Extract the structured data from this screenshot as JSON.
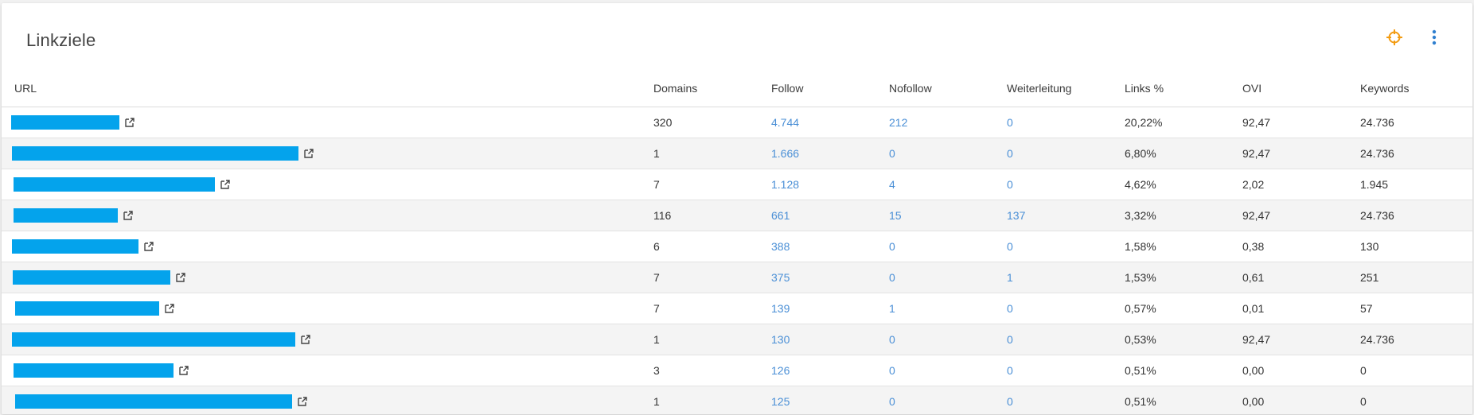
{
  "card": {
    "title": "Linkziele",
    "target_icon": "crosshair-icon",
    "more_icon": "more-vert-icon"
  },
  "colors": {
    "accent_orange": "#f39c12",
    "more_blue": "#2f7fcf",
    "link_blue": "#4a8fd6",
    "redaction_blue": "#04a3ec"
  },
  "table": {
    "headers": {
      "url": "URL",
      "domains": "Domains",
      "follow": "Follow",
      "nofollow": "Nofollow",
      "weiterleitung": "Weiterleitung",
      "links_pct": "Links %",
      "ovi": "OVI",
      "keywords": "Keywords"
    },
    "rows": [
      {
        "domains": "320",
        "follow": "4.744",
        "nofollow": "212",
        "weiterleitung": "0",
        "links_pct": "20,22%",
        "ovi": "92,47",
        "keywords": "24.736"
      },
      {
        "domains": "1",
        "follow": "1.666",
        "nofollow": "0",
        "weiterleitung": "0",
        "links_pct": "6,80%",
        "ovi": "92,47",
        "keywords": "24.736"
      },
      {
        "domains": "7",
        "follow": "1.128",
        "nofollow": "4",
        "weiterleitung": "0",
        "links_pct": "4,62%",
        "ovi": "2,02",
        "keywords": "1.945"
      },
      {
        "domains": "116",
        "follow": "661",
        "nofollow": "15",
        "weiterleitung": "137",
        "links_pct": "3,32%",
        "ovi": "92,47",
        "keywords": "24.736"
      },
      {
        "domains": "6",
        "follow": "388",
        "nofollow": "0",
        "weiterleitung": "0",
        "links_pct": "1,58%",
        "ovi": "0,38",
        "keywords": "130"
      },
      {
        "domains": "7",
        "follow": "375",
        "nofollow": "0",
        "weiterleitung": "1",
        "links_pct": "1,53%",
        "ovi": "0,61",
        "keywords": "251"
      },
      {
        "domains": "7",
        "follow": "139",
        "nofollow": "1",
        "weiterleitung": "0",
        "links_pct": "0,57%",
        "ovi": "0,01",
        "keywords": "57"
      },
      {
        "domains": "1",
        "follow": "130",
        "nofollow": "0",
        "weiterleitung": "0",
        "links_pct": "0,53%",
        "ovi": "92,47",
        "keywords": "24.736"
      },
      {
        "domains": "3",
        "follow": "126",
        "nofollow": "0",
        "weiterleitung": "0",
        "links_pct": "0,51%",
        "ovi": "0,00",
        "keywords": "0"
      },
      {
        "domains": "1",
        "follow": "125",
        "nofollow": "0",
        "weiterleitung": "0",
        "links_pct": "0,51%",
        "ovi": "0,00",
        "keywords": "0"
      }
    ]
  }
}
